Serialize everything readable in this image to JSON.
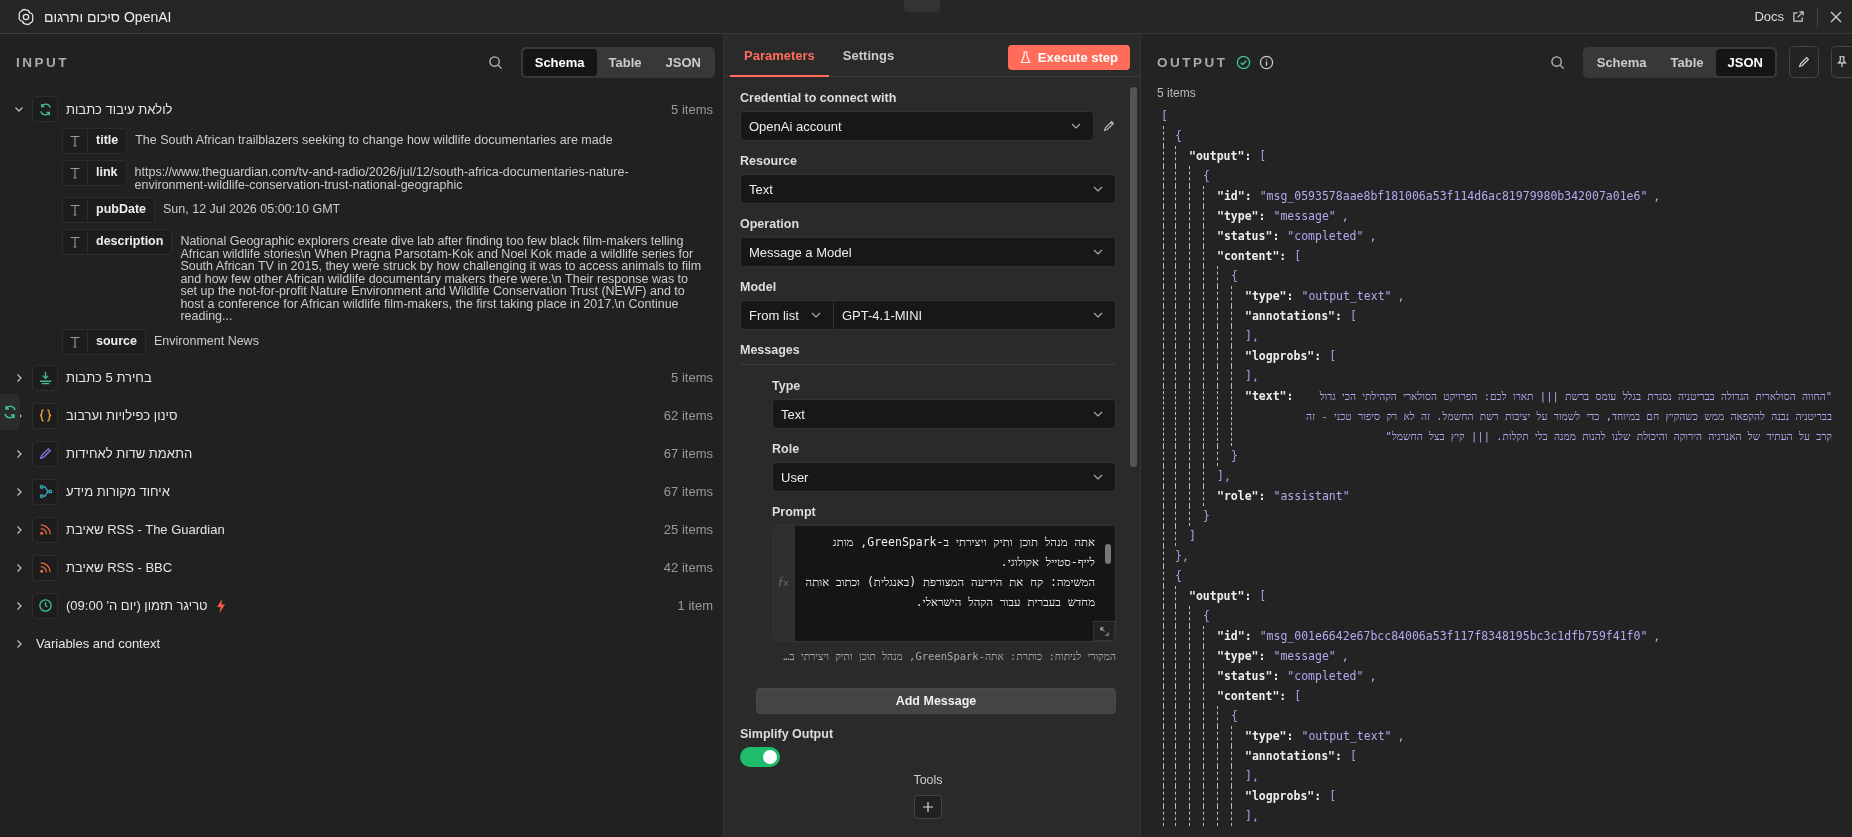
{
  "window": {
    "title": "סיכום ותרגום OpenAI",
    "docs_link": "Docs"
  },
  "input": {
    "title": "INPUT",
    "view_tabs": [
      {
        "label": "Schema",
        "selected": true
      },
      {
        "label": "Table",
        "selected": false
      },
      {
        "label": "JSON",
        "selected": false
      }
    ],
    "nodes": [
      {
        "kind": "loop",
        "label": "לולאת עיבוד כתבות",
        "count": "5 items",
        "expanded": true,
        "trigger": false,
        "fields": [
          {
            "key": "title",
            "value": "The South African trailblazers seeking to change how wildlife documentaries are made"
          },
          {
            "key": "link",
            "value": "https://www.theguardian.com/tv-and-radio/2026/jul/12/south-africa-documentaries-nature-environment-wildlife-conservation-trust-national-geographic"
          },
          {
            "key": "pubDate",
            "value": "Sun, 12 Jul 2026 05:00:10 GMT"
          },
          {
            "key": "description",
            "value": "National Geographic explorers create dive lab after finding too few black film-makers telling African wildlife stories\\n When Pragna Parsotam-Kok and Noel Kok made a wildlife series for South African TV in 2015, they were struck by how challenging it was to access animals to film and how few other African wildlife documentary makers there were.\\n Their response was to set up the not-for-profit Nature Environment and Wildlife Conservation Trust (NEWF) and to host a conference for African wildlife film-makers, the first taking place in 2017.\\n  Continue reading..."
          },
          {
            "key": "source",
            "value": "Environment News"
          }
        ]
      },
      {
        "kind": "download",
        "label": "בחירת 5 כתבות",
        "count": "5 items",
        "expanded": false,
        "trigger": false
      },
      {
        "kind": "code",
        "label": "סינון כפילויות וערבוב",
        "count": "62 items",
        "expanded": false,
        "trigger": false
      },
      {
        "kind": "pencil",
        "label": "התאמת שדות לאחידות",
        "count": "67 items",
        "expanded": false,
        "trigger": false
      },
      {
        "kind": "merge",
        "label": "איחוד מקורות מידע",
        "count": "67 items",
        "expanded": false,
        "trigger": false
      },
      {
        "kind": "rss",
        "label": "שאיבת RSS - The Guardian",
        "count": "25 items",
        "expanded": false,
        "trigger": false
      },
      {
        "kind": "rss",
        "label": "שאיבת RSS - BBC",
        "count": "42 items",
        "expanded": false,
        "trigger": false
      },
      {
        "kind": "clock",
        "label": "טריגר תזמון (יום ה' 09:00)",
        "count": "1 item",
        "expanded": false,
        "trigger": true
      },
      {
        "kind": "context",
        "label": "Variables and context",
        "expanded": false,
        "trigger": false
      }
    ]
  },
  "parameters": {
    "tabs": [
      {
        "label": "Parameters",
        "selected": true
      },
      {
        "label": "Settings",
        "selected": false
      }
    ],
    "execute_button": "Execute step",
    "credential": {
      "label": "Credential to connect with",
      "value": "OpenAi account"
    },
    "resource": {
      "label": "Resource",
      "value": "Text"
    },
    "operation": {
      "label": "Operation",
      "value": "Message a Model"
    },
    "model": {
      "label": "Model",
      "mode": "From list",
      "value": "GPT-4.1-MINI"
    },
    "messages": {
      "label": "Messages",
      "type": {
        "label": "Type",
        "value": "Text"
      },
      "role": {
        "label": "Role",
        "value": "User"
      },
      "prompt": {
        "label": "Prompt",
        "lines": [
          "אתה מנהל תוכן ותיק ויצירתי ב-GreenSpark, מותג לייף-סטייל אקולוגי.",
          "המשימה: קח את הידיעה המצורפת (באנגלית) וכתוב אותה מחדש בעברית עבור הקהל הישראלי."
        ],
        "hint": "המקורי לניתוח: כותרת: אתה-GreenSpark, מנהל תוכן ותיק ויצירתי ב…"
      }
    },
    "add_message": "Add Message",
    "simplify": {
      "label": "Simplify Output",
      "on": true
    },
    "tools": "Tools"
  },
  "output": {
    "title": "OUTPUT",
    "view_tabs": [
      {
        "label": "Schema",
        "selected": false
      },
      {
        "label": "Table",
        "selected": false
      },
      {
        "label": "JSON",
        "selected": true
      }
    ],
    "count": "5 items",
    "json": {
      "open": "[",
      "children": [
        {
          "open": "{",
          "close": "},",
          "children": [
            {
              "key": "\"output\":",
              "open": "[",
              "close": "]",
              "children": [
                {
                  "open": "{",
                  "close": "}",
                  "children": [
                    {
                      "key": "\"id\":",
                      "value": "\"msg_0593578aae8bf181006a53f114d6ac81979980b342007a01e6\"",
                      "tail": ","
                    },
                    {
                      "key": "\"type\":",
                      "value": "\"message\"",
                      "tail": ","
                    },
                    {
                      "key": "\"status\":",
                      "value": "\"completed\"",
                      "tail": ","
                    },
                    {
                      "key": "\"content\":",
                      "open": "[",
                      "close": "],",
                      "children": [
                        {
                          "open": "{",
                          "close": "}",
                          "children": [
                            {
                              "key": "\"type\":",
                              "value": "\"output_text\"",
                              "tail": ","
                            },
                            {
                              "key": "\"annotations\":",
                              "open": "[",
                              "close": "],"
                            },
                            {
                              "key": "\"logprobs\":",
                              "open": "[",
                              "close": "],"
                            },
                            {
                              "key": "\"text\":",
                              "value": "\"החווה הסולארית הגדולה בבריטניה נסגרת בגלל עומס ברשת ||| תארו לכם: הפרויקט הסולארי הקהילתי הכי גדול בבריטניה נבנה להקפאה ממש כשהקיץ חם במיוחד, כדי לשמור על יציבות רשת החשמל. זה לא רק סיפור טכני - זה קרב על העתיד של האנרגיה הירוקה והיכולת שלנו להנות ממנה בלי תקלות. ||| קיץ בצל החשמל\""
                            }
                          ]
                        }
                      ]
                    },
                    {
                      "key": "\"role\":",
                      "value": "\"assistant\""
                    }
                  ]
                }
              ]
            }
          ]
        },
        {
          "open": "{",
          "children": [
            {
              "key": "\"output\":",
              "open": "[",
              "children": [
                {
                  "open": "{",
                  "children": [
                    {
                      "key": "\"id\":",
                      "value": "\"msg_001e6642e67bcc84006a53f117f8348195bc3c1dfb759f41f0\"",
                      "tail": ","
                    },
                    {
                      "key": "\"type\":",
                      "value": "\"message\"",
                      "tail": ","
                    },
                    {
                      "key": "\"status\":",
                      "value": "\"completed\"",
                      "tail": ","
                    },
                    {
                      "key": "\"content\":",
                      "open": "[",
                      "children": [
                        {
                          "open": "{",
                          "children": [
                            {
                              "key": "\"type\":",
                              "value": "\"output_text\"",
                              "tail": ","
                            },
                            {
                              "key": "\"annotations\":",
                              "open": "[",
                              "close": "],"
                            },
                            {
                              "key": "\"logprobs\":",
                              "open": "[",
                              "close": "],"
                            }
                          ]
                        }
                      ]
                    }
                  ]
                }
              ]
            }
          ]
        }
      ]
    }
  }
}
